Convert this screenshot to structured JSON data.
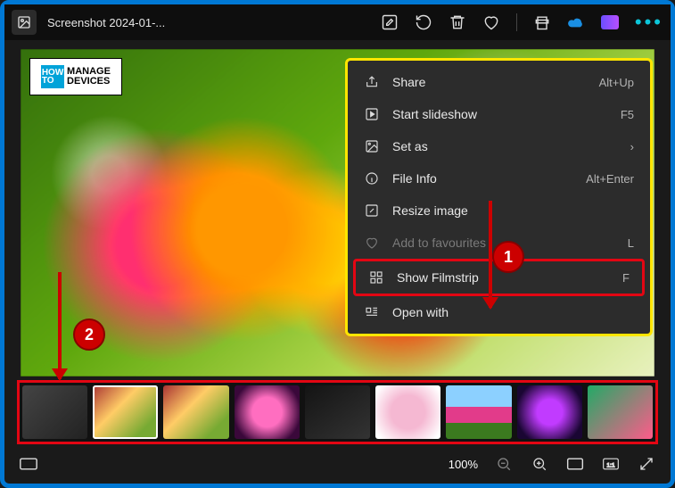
{
  "titlebar": {
    "title": "Screenshot 2024-01-..."
  },
  "watermark": {
    "box": "HOW\nTO",
    "text": "MANAGE\nDEVICES"
  },
  "menu": {
    "items": [
      {
        "icon": "share-icon",
        "label": "Share",
        "shortcut": "Alt+Up"
      },
      {
        "icon": "play-icon",
        "label": "Start slideshow",
        "shortcut": "F5"
      },
      {
        "icon": "setas-icon",
        "label": "Set as",
        "shortcut": "›"
      },
      {
        "icon": "info-icon",
        "label": "File Info",
        "shortcut": "Alt+Enter"
      },
      {
        "icon": "resize-icon",
        "label": "Resize image",
        "shortcut": ""
      },
      {
        "icon": "heart-icon",
        "label": "Add to favourites",
        "shortcut": "L",
        "disabled": true
      },
      {
        "icon": "filmstrip-icon",
        "label": "Show Filmstrip",
        "shortcut": "F",
        "highlight": true
      },
      {
        "icon": "openwith-icon",
        "label": "Open with",
        "shortcut": ""
      }
    ]
  },
  "bottombar": {
    "zoom": "100%"
  },
  "annotations": {
    "badge1": "1",
    "badge2": "2"
  }
}
